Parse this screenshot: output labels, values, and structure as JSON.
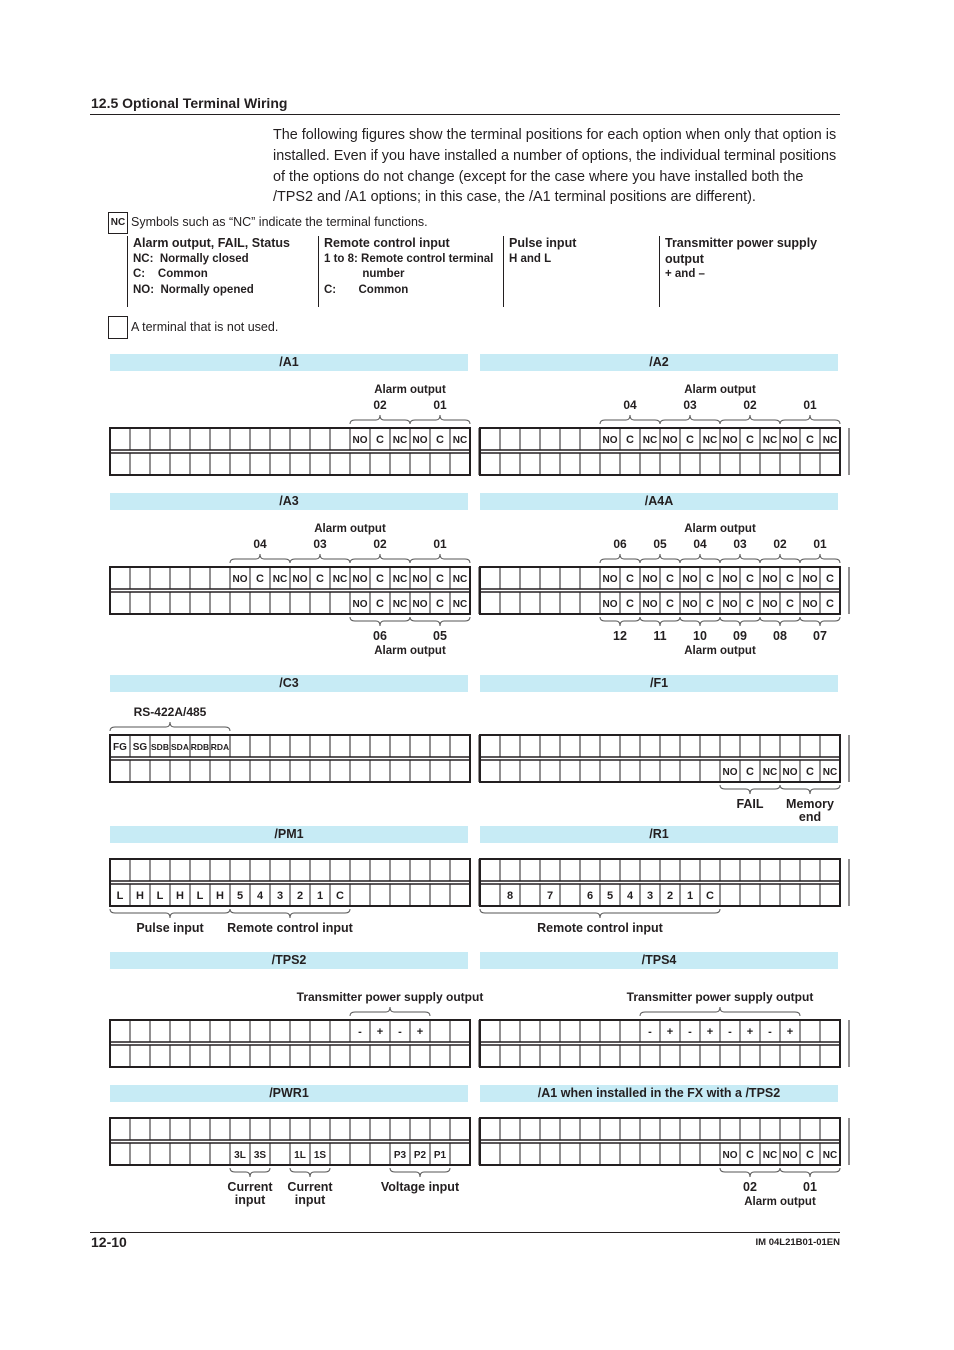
{
  "section_title": "12.5  Optional Terminal Wiring",
  "intro": "The following figures show the terminal positions for each option when only that option is installed. Even if you have installed a number of options, the individual terminal positions of the options do not change (except for the case where you have installed both the /TPS2 and /A1 options; in this case, the /A1 terminal positions are different).",
  "legend": {
    "symbol_example": "NC",
    "symbol_text": "Symbols such as “NC” indicate the terminal functions.",
    "columns": [
      {
        "heading": "Alarm output, FAIL, Status",
        "lines": [
          "NC:  Normally closed",
          "C:    Common",
          "NO:  Normally opened"
        ]
      },
      {
        "heading": "Remote control input",
        "lines": [
          "1 to 8: Remote control terminal",
          "            number",
          "C:       Common"
        ]
      },
      {
        "heading": "Pulse input",
        "lines": [
          "H and L"
        ]
      },
      {
        "heading": "Transmitter power supply output",
        "lines": [
          "+ and –"
        ]
      }
    ],
    "unused_text": "A terminal that is not used."
  },
  "diagrams": [
    {
      "name": "/A1",
      "top": [
        "",
        "",
        "",
        "",
        "",
        "",
        "",
        "",
        "",
        "",
        "",
        "",
        "NO",
        "C",
        "NC",
        "NO",
        "C",
        "NC"
      ],
      "bottom": [
        "",
        "",
        "",
        "",
        "",
        "",
        "",
        "",
        "",
        "",
        "",
        "",
        "",
        "",
        "",
        "",
        "",
        ""
      ],
      "above": {
        "title": "Alarm output",
        "groups": [
          {
            "from": 13,
            "to": 15,
            "label": "02"
          },
          {
            "from": 16,
            "to": 18,
            "label": "01"
          }
        ]
      }
    },
    {
      "name": "/A2",
      "top": [
        "",
        "",
        "",
        "",
        "",
        "",
        "NO",
        "C",
        "NC",
        "NO",
        "C",
        "NC",
        "NO",
        "C",
        "NC",
        "NO",
        "C",
        "NC"
      ],
      "bottom": [
        "",
        "",
        "",
        "",
        "",
        "",
        "",
        "",
        "",
        "",
        "",
        "",
        "",
        "",
        "",
        "",
        "",
        ""
      ],
      "above": {
        "title": "Alarm output",
        "groups": [
          {
            "from": 7,
            "to": 9,
            "label": "04"
          },
          {
            "from": 10,
            "to": 12,
            "label": "03"
          },
          {
            "from": 13,
            "to": 15,
            "label": "02"
          },
          {
            "from": 16,
            "to": 18,
            "label": "01"
          }
        ]
      }
    },
    {
      "name": "/A3",
      "top": [
        "",
        "",
        "",
        "",
        "",
        "",
        "NO",
        "C",
        "NC",
        "NO",
        "C",
        "NC",
        "NO",
        "C",
        "NC",
        "NO",
        "C",
        "NC"
      ],
      "bottom": [
        "",
        "",
        "",
        "",
        "",
        "",
        "",
        "",
        "",
        "",
        "",
        "",
        "NO",
        "C",
        "NC",
        "NO",
        "C",
        "NC"
      ],
      "above": {
        "title": "Alarm output",
        "groups": [
          {
            "from": 7,
            "to": 9,
            "label": "04"
          },
          {
            "from": 10,
            "to": 12,
            "label": "03"
          },
          {
            "from": 13,
            "to": 15,
            "label": "02"
          },
          {
            "from": 16,
            "to": 18,
            "label": "01"
          }
        ]
      },
      "below": {
        "title": "Alarm output",
        "groups": [
          {
            "from": 13,
            "to": 15,
            "label": "06"
          },
          {
            "from": 16,
            "to": 18,
            "label": "05"
          }
        ]
      }
    },
    {
      "name": "/A4A",
      "top": [
        "",
        "",
        "",
        "",
        "",
        "",
        "NO",
        "C",
        "NO",
        "C",
        "NO",
        "C",
        "NO",
        "C",
        "NO",
        "C",
        "NO",
        "C"
      ],
      "bottom": [
        "",
        "",
        "",
        "",
        "",
        "",
        "NO",
        "C",
        "NO",
        "C",
        "NO",
        "C",
        "NO",
        "C",
        "NO",
        "C",
        "NO",
        "C"
      ],
      "above": {
        "title": "Alarm output",
        "groups": [
          {
            "from": 7,
            "to": 8,
            "label": "06"
          },
          {
            "from": 9,
            "to": 10,
            "label": "05"
          },
          {
            "from": 11,
            "to": 12,
            "label": "04"
          },
          {
            "from": 13,
            "to": 14,
            "label": "03"
          },
          {
            "from": 15,
            "to": 16,
            "label": "02"
          },
          {
            "from": 17,
            "to": 18,
            "label": "01"
          }
        ]
      },
      "below": {
        "title": "Alarm output",
        "groups": [
          {
            "from": 7,
            "to": 8,
            "label": "12"
          },
          {
            "from": 9,
            "to": 10,
            "label": "11"
          },
          {
            "from": 11,
            "to": 12,
            "label": "10"
          },
          {
            "from": 13,
            "to": 14,
            "label": "09"
          },
          {
            "from": 15,
            "to": 16,
            "label": "08"
          },
          {
            "from": 17,
            "to": 18,
            "label": "07"
          }
        ]
      }
    },
    {
      "name": "/C3",
      "top": [
        "FG",
        "SG",
        "SDB",
        "SDA",
        "RDB",
        "RDA",
        "",
        "",
        "",
        "",
        "",
        "",
        "",
        "",
        "",
        "",
        "",
        ""
      ],
      "bottom": [
        "",
        "",
        "",
        "",
        "",
        "",
        "",
        "",
        "",
        "",
        "",
        "",
        "",
        "",
        "",
        "",
        "",
        ""
      ],
      "above": {
        "title": "",
        "groups": [
          {
            "from": 1,
            "to": 6,
            "label": "RS-422A/485"
          }
        ]
      }
    },
    {
      "name": "/F1",
      "top": [
        "",
        "",
        "",
        "",
        "",
        "",
        "",
        "",
        "",
        "",
        "",
        "",
        "",
        "",
        "",
        "",
        "",
        ""
      ],
      "bottom": [
        "",
        "",
        "",
        "",
        "",
        "",
        "",
        "",
        "",
        "",
        "",
        "",
        "NO",
        "C",
        "NC",
        "NO",
        "C",
        "NC"
      ],
      "below": {
        "title": "",
        "groups": [
          {
            "from": 13,
            "to": 15,
            "label": "FAIL"
          },
          {
            "from": 16,
            "to": 18,
            "label": "Memory\nend"
          }
        ]
      }
    },
    {
      "name": "/PM1",
      "top": [
        "",
        "",
        "",
        "",
        "",
        "",
        "",
        "",
        "",
        "",
        "",
        "",
        "",
        "",
        "",
        "",
        "",
        ""
      ],
      "bottom": [
        "L",
        "H",
        "L",
        "H",
        "L",
        "H",
        "5",
        "4",
        "3",
        "2",
        "1",
        "C",
        "",
        "",
        "",
        "",
        "",
        ""
      ],
      "below": {
        "title": "",
        "groups": [
          {
            "from": 1,
            "to": 6,
            "label": "Pulse input"
          },
          {
            "from": 7,
            "to": 12,
            "label": "Remote control input"
          }
        ]
      }
    },
    {
      "name": "/R1",
      "top": [
        "",
        "",
        "",
        "",
        "",
        "",
        "",
        "",
        "",
        "",
        "",
        "",
        "",
        "",
        "",
        "",
        "",
        ""
      ],
      "bottom": [
        "",
        "8",
        "",
        "7",
        "",
        "6",
        "5",
        "4",
        "3",
        "2",
        "1",
        "C",
        "",
        "",
        "",
        "",
        "",
        ""
      ],
      "below": {
        "title": "",
        "groups": [
          {
            "from": 1,
            "to": 12,
            "label": "Remote control input"
          }
        ]
      }
    },
    {
      "name": "/TPS2",
      "top": [
        "",
        "",
        "",
        "",
        "",
        "",
        "",
        "",
        "",
        "",
        "",
        "",
        "-",
        "+",
        "-",
        "+",
        "",
        ""
      ],
      "bottom": [
        "",
        "",
        "",
        "",
        "",
        "",
        "",
        "",
        "",
        "",
        "",
        "",
        "",
        "",
        "",
        "",
        "",
        ""
      ],
      "above": {
        "title": "",
        "groups": [
          {
            "from": 13,
            "to": 16,
            "label": "Transmitter power supply output"
          }
        ]
      }
    },
    {
      "name": "/TPS4",
      "top": [
        "",
        "",
        "",
        "",
        "",
        "",
        "",
        "",
        "-",
        "+",
        "-",
        "+",
        "-",
        "+",
        "-",
        "+",
        "",
        ""
      ],
      "bottom": [
        "",
        "",
        "",
        "",
        "",
        "",
        "",
        "",
        "",
        "",
        "",
        "",
        "",
        "",
        "",
        "",
        "",
        ""
      ],
      "above": {
        "title": "",
        "groups": [
          {
            "from": 9,
            "to": 16,
            "label": "Transmitter power supply output"
          }
        ]
      }
    },
    {
      "name": "/PWR1",
      "top": [
        "",
        "",
        "",
        "",
        "",
        "",
        "",
        "",
        "",
        "",
        "",
        "",
        "",
        "",
        "",
        "",
        "",
        ""
      ],
      "bottom": [
        "",
        "",
        "",
        "",
        "",
        "",
        "3L",
        "3S",
        "",
        "1L",
        "1S",
        "",
        "",
        "",
        "P3",
        "P2",
        "P1",
        ""
      ],
      "below": {
        "title": "",
        "groups": [
          {
            "from": 7,
            "to": 8,
            "label": "Current\ninput"
          },
          {
            "from": 10,
            "to": 11,
            "label": "Current\ninput"
          },
          {
            "from": 15,
            "to": 17,
            "label": "Voltage input"
          }
        ]
      }
    },
    {
      "name": "/A1 when installed in the FX with a /TPS2",
      "top": [
        "",
        "",
        "",
        "",
        "",
        "",
        "",
        "",
        "",
        "",
        "",
        "",
        "",
        "",
        "",
        "",
        "",
        ""
      ],
      "bottom": [
        "",
        "",
        "",
        "",
        "",
        "",
        "",
        "",
        "",
        "",
        "",
        "",
        "NO",
        "C",
        "NC",
        "NO",
        "C",
        "NC"
      ],
      "below": {
        "title": "Alarm output",
        "groups": [
          {
            "from": 13,
            "to": 15,
            "label": "02"
          },
          {
            "from": 16,
            "to": 18,
            "label": "01"
          }
        ]
      }
    }
  ],
  "footer": {
    "page_number": "12-10",
    "doc_id": "IM 04L21B01-01EN"
  },
  "colors": {
    "section_bar": "#c7ebf5",
    "text": "#231f20"
  }
}
